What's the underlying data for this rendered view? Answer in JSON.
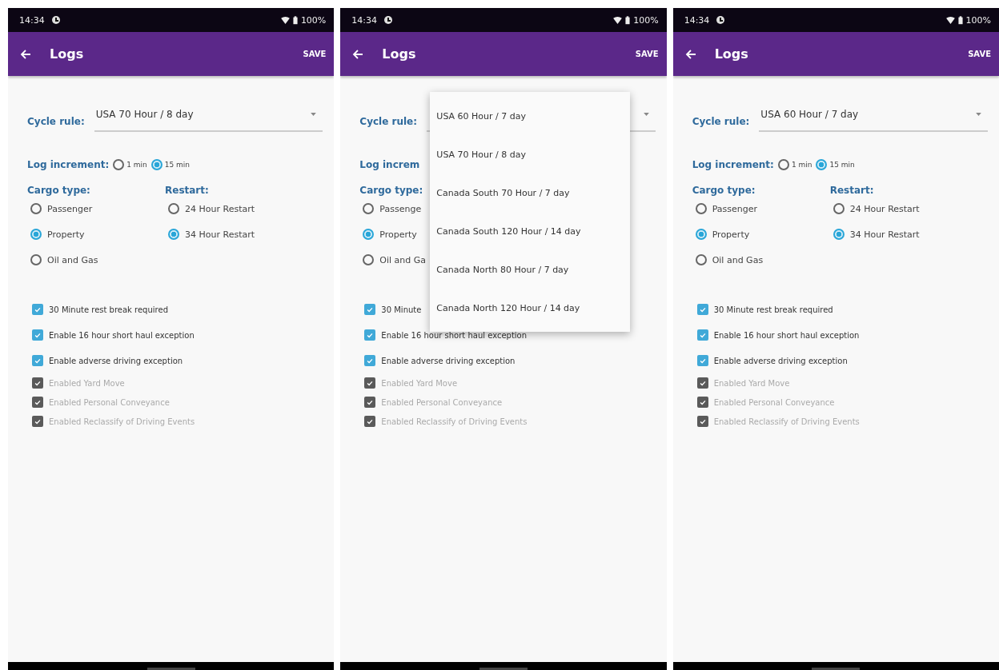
{
  "screens": [
    {
      "status_bar": {
        "time": "14:34",
        "battery": "100%"
      },
      "app_bar": {
        "title": "Logs",
        "action": "SAVE"
      },
      "cycle_rule": {
        "label": "Cycle rule:",
        "value": "USA 70 Hour / 8 day"
      },
      "log_increment": {
        "label": "Log increment:",
        "options": [
          {
            "label": "1 min",
            "selected": false
          },
          {
            "label": "15 min",
            "selected": true
          }
        ]
      },
      "cargo_type": {
        "label": "Cargo type:",
        "options": [
          {
            "label": "Passenger",
            "selected": false
          },
          {
            "label": "Property",
            "selected": true
          },
          {
            "label": "Oil and Gas",
            "selected": false
          }
        ]
      },
      "restart": {
        "label": "Restart:",
        "options": [
          {
            "label": "24 Hour Restart",
            "selected": false
          },
          {
            "label": "34 Hour Restart",
            "selected": true
          }
        ]
      },
      "checkboxes": [
        {
          "label": "30 Minute rest break required",
          "checked": true,
          "disabled": false
        },
        {
          "label": "Enable 16 hour short haul exception",
          "checked": true,
          "disabled": false
        },
        {
          "label": "Enable adverse driving exception",
          "checked": true,
          "disabled": false
        },
        {
          "label": "Enabled Yard Move",
          "checked": true,
          "disabled": true
        },
        {
          "label": "Enabled Personal Conveyance",
          "checked": true,
          "disabled": true
        },
        {
          "label": "Enabled Reclassify of Driving Events",
          "checked": true,
          "disabled": true
        }
      ]
    },
    {
      "status_bar": {
        "time": "14:34",
        "battery": "100%"
      },
      "app_bar": {
        "title": "Logs",
        "action": "SAVE"
      },
      "cycle_rule": {
        "label": "Cycle rule:"
      },
      "log_increment": {
        "label": "Log increm"
      },
      "cargo_type": {
        "label": "Cargo type:",
        "options": [
          {
            "label": "Passenge",
            "selected": false
          },
          {
            "label": "Property",
            "selected": true
          },
          {
            "label": "Oil and Ga",
            "selected": false
          }
        ]
      },
      "checkboxes": [
        {
          "label": "30 Minute",
          "checked": true,
          "disabled": false
        },
        {
          "label": "Enable 16 hour short haul exception",
          "checked": true,
          "disabled": false
        },
        {
          "label": "Enable adverse driving exception",
          "checked": true,
          "disabled": false
        },
        {
          "label": "Enabled Yard Move",
          "checked": true,
          "disabled": true
        },
        {
          "label": "Enabled Personal Conveyance",
          "checked": true,
          "disabled": true
        },
        {
          "label": "Enabled Reclassify of Driving Events",
          "checked": true,
          "disabled": true
        }
      ],
      "menu": {
        "items": [
          "USA 60 Hour / 7 day",
          "USA 70 Hour / 8 day",
          "Canada South 70 Hour / 7 day",
          "Canada South 120 Hour / 14 day",
          "Canada North 80 Hour / 7 day",
          "Canada North 120 Hour / 14 day"
        ]
      }
    },
    {
      "status_bar": {
        "time": "14:34",
        "battery": "100%"
      },
      "app_bar": {
        "title": "Logs",
        "action": "SAVE"
      },
      "cycle_rule": {
        "label": "Cycle rule:",
        "value": "USA 60 Hour / 7 day"
      },
      "log_increment": {
        "label": "Log increment:",
        "options": [
          {
            "label": "1 min",
            "selected": false
          },
          {
            "label": "15 min",
            "selected": true
          }
        ]
      },
      "cargo_type": {
        "label": "Cargo type:",
        "options": [
          {
            "label": "Passenger",
            "selected": false
          },
          {
            "label": "Property",
            "selected": true
          },
          {
            "label": "Oil and Gas",
            "selected": false
          }
        ]
      },
      "restart": {
        "label": "Restart:",
        "options": [
          {
            "label": "24 Hour Restart",
            "selected": false
          },
          {
            "label": "34 Hour Restart",
            "selected": true
          }
        ]
      },
      "checkboxes": [
        {
          "label": "30 Minute rest break required",
          "checked": true,
          "disabled": false
        },
        {
          "label": "Enable 16 hour short haul exception",
          "checked": true,
          "disabled": false
        },
        {
          "label": "Enable adverse driving exception",
          "checked": true,
          "disabled": false
        },
        {
          "label": "Enabled Yard Move",
          "checked": true,
          "disabled": true
        },
        {
          "label": "Enabled Personal Conveyance",
          "checked": true,
          "disabled": true
        },
        {
          "label": "Enabled Reclassify of Driving Events",
          "checked": true,
          "disabled": true
        }
      ]
    }
  ]
}
